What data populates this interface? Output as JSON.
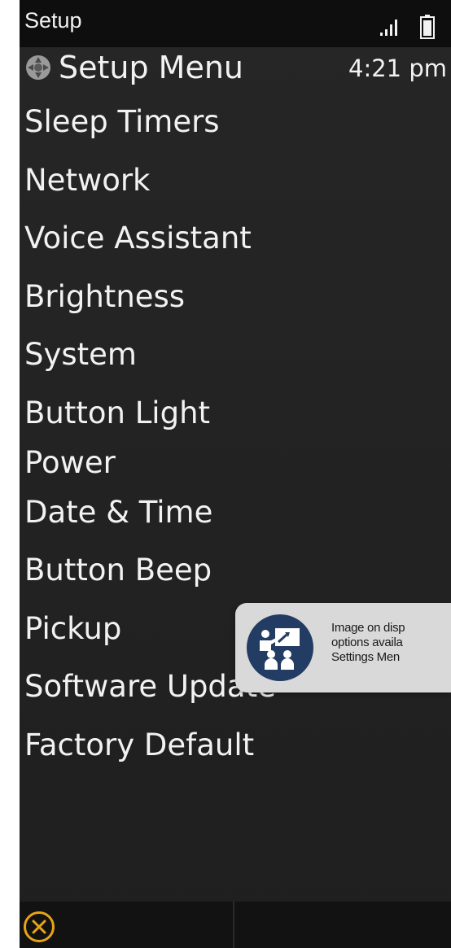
{
  "statusbar": {
    "title": "Setup",
    "signal_icon": "signal-icon",
    "battery_icon": "battery-icon"
  },
  "header": {
    "icon": "setup-dial-icon",
    "title": "Setup Menu",
    "time": "4:21 pm"
  },
  "menu": {
    "items": [
      {
        "label": "Sleep Timers"
      },
      {
        "label": "Network"
      },
      {
        "label": "Voice Assistant"
      },
      {
        "label": "Brightness"
      },
      {
        "label": "System"
      },
      {
        "label": "Button Light"
      },
      {
        "label": "Power"
      },
      {
        "label": "Date & Time"
      },
      {
        "label": "Button Beep"
      },
      {
        "label": "Pickup"
      },
      {
        "label": "Software Update"
      },
      {
        "label": "Factory Default"
      }
    ]
  },
  "bottombar": {
    "close_icon": "close-icon"
  },
  "tooltip": {
    "icon": "presenter-icon",
    "lines": [
      "Image on disp",
      "options availa",
      "Settings Men"
    ]
  },
  "colors": {
    "background": "#242424",
    "text": "#f2f2f2",
    "accent": "#e8a418",
    "tooltip_bg": "#d9d9d9",
    "tooltip_icon_bg": "#233c63"
  }
}
